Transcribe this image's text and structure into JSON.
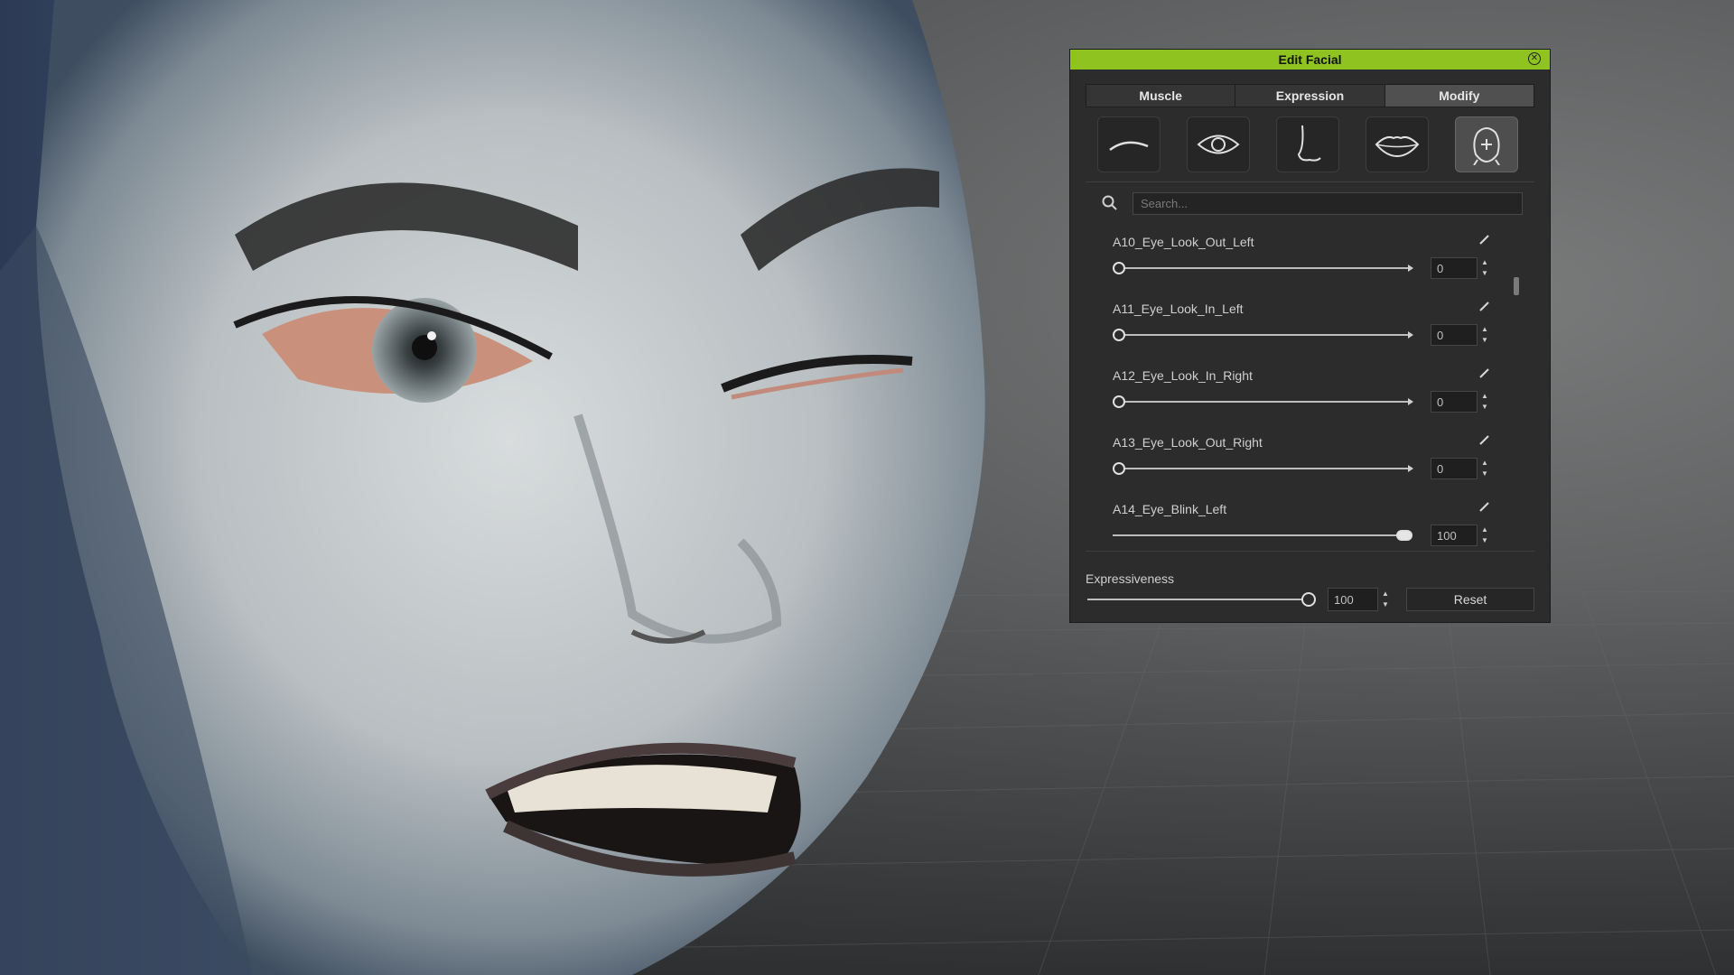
{
  "viewport": {
    "subject": "3d-face-model"
  },
  "panel": {
    "title": "Edit Facial",
    "close_icon": "close-icon",
    "tabs": [
      {
        "label": "Muscle",
        "active": false
      },
      {
        "label": "Expression",
        "active": false
      },
      {
        "label": "Modify",
        "active": true
      }
    ],
    "parts": [
      {
        "icon": "eyebrow-icon",
        "active": false
      },
      {
        "icon": "eye-icon",
        "active": false
      },
      {
        "icon": "nose-icon",
        "active": false
      },
      {
        "icon": "lips-icon",
        "active": false
      },
      {
        "icon": "head-icon",
        "active": true
      }
    ],
    "search": {
      "placeholder": "Search..."
    },
    "morphs": [
      {
        "name": "A10_Eye_Look_Out_Left",
        "value": "0",
        "fraction": 0.0
      },
      {
        "name": "A11_Eye_Look_In_Left",
        "value": "0",
        "fraction": 0.0
      },
      {
        "name": "A12_Eye_Look_In_Right",
        "value": "0",
        "fraction": 0.0
      },
      {
        "name": "A13_Eye_Look_Out_Right",
        "value": "0",
        "fraction": 0.0
      },
      {
        "name": "A14_Eye_Blink_Left",
        "value": "100",
        "fraction": 1.0
      }
    ],
    "expressiveness": {
      "label": "Expressiveness",
      "value": "100"
    },
    "reset_label": "Reset"
  }
}
